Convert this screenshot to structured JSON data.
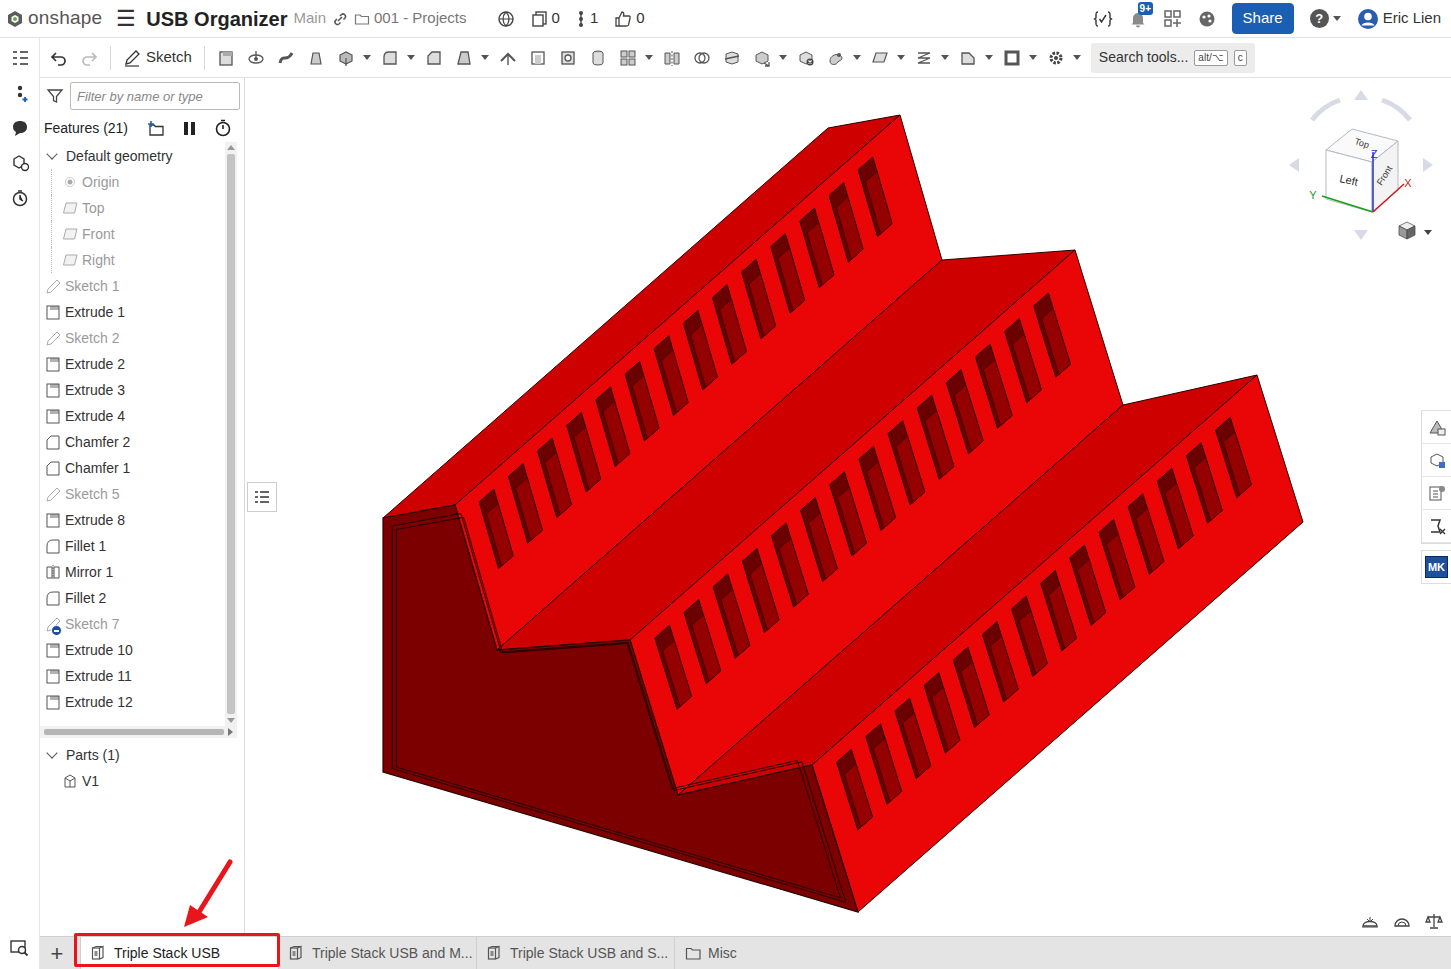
{
  "header": {
    "logo": "onshape",
    "menu": "☰",
    "title": "USB Organizer",
    "branch": "Main",
    "folder": "001 - Projects",
    "versions": "0",
    "branches": "1",
    "likes": "0",
    "notifications": "9+",
    "share": "Share",
    "help": "?",
    "user": "Eric Lien"
  },
  "toolbar": {
    "sketch": "Sketch",
    "search": "Search tools...",
    "shortcut_keys": [
      "alt/⌥",
      "c"
    ]
  },
  "feature_panel": {
    "filter_placeholder": "Filter by name or type",
    "title": "Features (21)"
  },
  "default_geometry": {
    "label": "Default geometry",
    "expanded": true,
    "items": [
      {
        "name": "Origin",
        "kind": "origin",
        "hidden": true
      },
      {
        "name": "Top",
        "kind": "plane",
        "hidden": true
      },
      {
        "name": "Front",
        "kind": "plane",
        "hidden": true
      },
      {
        "name": "Right",
        "kind": "plane",
        "hidden": true
      }
    ]
  },
  "features": [
    {
      "name": "Sketch 1",
      "kind": "sketch",
      "hidden": true,
      "flagged": false
    },
    {
      "name": "Extrude 1",
      "kind": "extrude",
      "hidden": false,
      "flagged": false
    },
    {
      "name": "Sketch 2",
      "kind": "sketch",
      "hidden": true,
      "flagged": false
    },
    {
      "name": "Extrude 2",
      "kind": "extrude",
      "hidden": false,
      "flagged": false
    },
    {
      "name": "Extrude 3",
      "kind": "extrude",
      "hidden": false,
      "flagged": false
    },
    {
      "name": "Extrude 4",
      "kind": "extrude",
      "hidden": false,
      "flagged": false
    },
    {
      "name": "Chamfer 2",
      "kind": "chamfer",
      "hidden": false,
      "flagged": false
    },
    {
      "name": "Chamfer 1",
      "kind": "chamfer",
      "hidden": false,
      "flagged": false
    },
    {
      "name": "Sketch 5",
      "kind": "sketch",
      "hidden": true,
      "flagged": false
    },
    {
      "name": "Extrude 8",
      "kind": "extrude",
      "hidden": false,
      "flagged": false
    },
    {
      "name": "Fillet 1",
      "kind": "fillet",
      "hidden": false,
      "flagged": false
    },
    {
      "name": "Mirror 1",
      "kind": "mirror",
      "hidden": false,
      "flagged": false
    },
    {
      "name": "Fillet 2",
      "kind": "fillet",
      "hidden": false,
      "flagged": false
    },
    {
      "name": "Sketch 7",
      "kind": "sketch",
      "hidden": true,
      "flagged": true
    },
    {
      "name": "Extrude 10",
      "kind": "extrude",
      "hidden": false,
      "flagged": false
    },
    {
      "name": "Extrude 11",
      "kind": "extrude",
      "hidden": false,
      "flagged": false
    },
    {
      "name": "Extrude 12",
      "kind": "extrude",
      "hidden": false,
      "flagged": false
    }
  ],
  "parts": {
    "label": "Parts (1)",
    "expanded": true,
    "items": [
      {
        "name": "V1"
      }
    ]
  },
  "view_cube": {
    "top": "Top",
    "left": "Left",
    "front": "Front",
    "x": "X",
    "y": "Y",
    "z": "Z"
  },
  "side_tools": {
    "mk": "MK"
  },
  "add_tab": "+",
  "tabs": [
    {
      "label": "Triple Stack USB",
      "kind": "part-studio",
      "selected": true
    },
    {
      "label": "Triple Stack USB and M...",
      "kind": "part-studio",
      "selected": false
    },
    {
      "label": "Triple Stack USB and S...",
      "kind": "part-studio",
      "selected": false
    },
    {
      "label": "Misc",
      "kind": "folder",
      "selected": false
    }
  ]
}
